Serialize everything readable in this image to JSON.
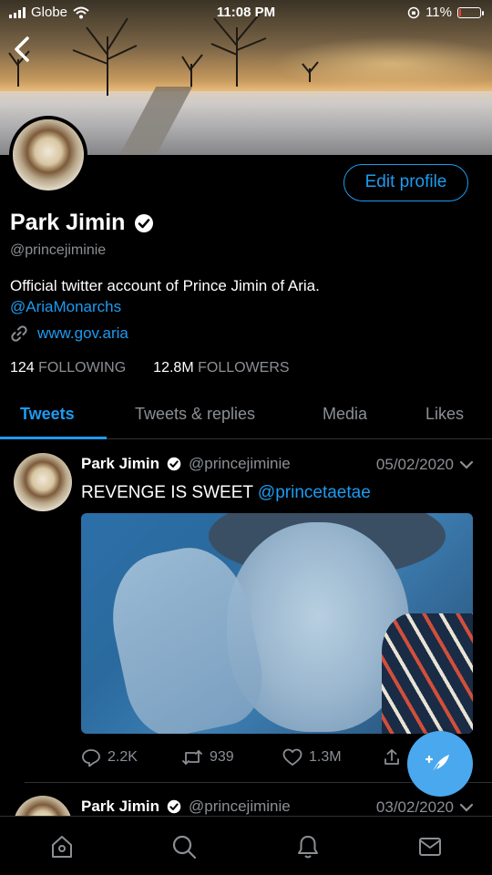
{
  "status_bar": {
    "carrier": "Globe",
    "time": "11:08 PM",
    "battery": "11%",
    "battery_level": 0.11
  },
  "profile": {
    "name": "Park Jimin",
    "handle": "@princejiminie",
    "bio": "Official twitter account of Prince Jimin of Aria.",
    "bio_mention": "@AriaMonarchs",
    "link": "www.gov.aria",
    "following_count": "124",
    "following_label": "FOLLOWING",
    "followers_count": "12.8M",
    "followers_label": "FOLLOWERS",
    "edit_label": "Edit profile"
  },
  "tabs": [
    {
      "label": "Tweets",
      "active": true
    },
    {
      "label": "Tweets & replies",
      "active": false
    },
    {
      "label": "Media",
      "active": false
    },
    {
      "label": "Likes",
      "active": false
    }
  ],
  "tweets": [
    {
      "name": "Park Jimin",
      "handle": "@princejiminie",
      "date": "05/02/2020",
      "text": "REVENGE IS SWEET",
      "mention": "@princetaetae",
      "replies": "2.2K",
      "retweets": "939",
      "likes": "1.3M"
    },
    {
      "name": "Park Jimin",
      "handle": "@princejiminie",
      "date": "03/02/2020"
    }
  ],
  "colors": {
    "accent": "#1d9bf0",
    "background": "#000000",
    "muted": "#8b8f94"
  },
  "icons": {
    "back": "chevron-left-icon",
    "verified": "verified-badge-icon",
    "link": "link-icon",
    "compose": "compose-feather-icon",
    "nav": [
      "home-icon",
      "search-icon",
      "bell-icon",
      "mail-icon"
    ]
  }
}
